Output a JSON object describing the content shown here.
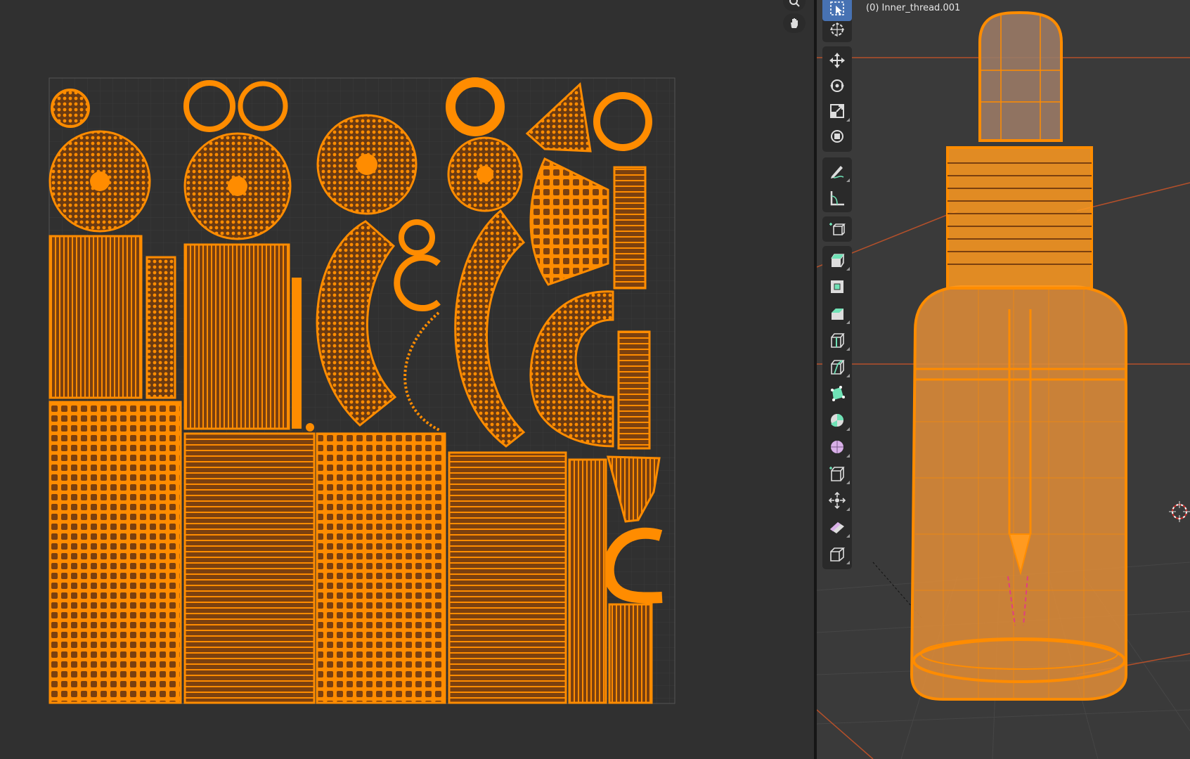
{
  "uv_editor": {
    "background": "#303030",
    "image_frame_color": "#3c3c3c",
    "selection_color": "#ff8c00",
    "nav_buttons": [
      {
        "name": "zoom-icon"
      },
      {
        "name": "hand-pan-icon"
      }
    ]
  },
  "viewport": {
    "object_label": "(0) Inner_thread.001",
    "wire_color": "#ff8c00",
    "grid_line_color": "#b5502a",
    "toolbar": [
      {
        "name": "select-box-icon",
        "active": true
      },
      {
        "name": "cursor-icon"
      },
      {
        "name": "move-icon"
      },
      {
        "name": "rotate-icon"
      },
      {
        "name": "scale-icon"
      },
      {
        "name": "transform-icon"
      },
      {
        "name": "annotate-icon"
      },
      {
        "name": "measure-icon"
      },
      {
        "name": "add-cube-icon"
      },
      {
        "name": "extrude-region-icon"
      },
      {
        "name": "inset-faces-icon"
      },
      {
        "name": "bevel-icon"
      },
      {
        "name": "loop-cut-icon"
      },
      {
        "name": "knife-icon"
      },
      {
        "name": "poly-build-icon"
      },
      {
        "name": "spin-icon"
      },
      {
        "name": "smooth-icon"
      },
      {
        "name": "edge-slide-icon"
      },
      {
        "name": "shrink-fatten-icon"
      },
      {
        "name": "shear-icon"
      },
      {
        "name": "rip-region-icon"
      }
    ]
  }
}
